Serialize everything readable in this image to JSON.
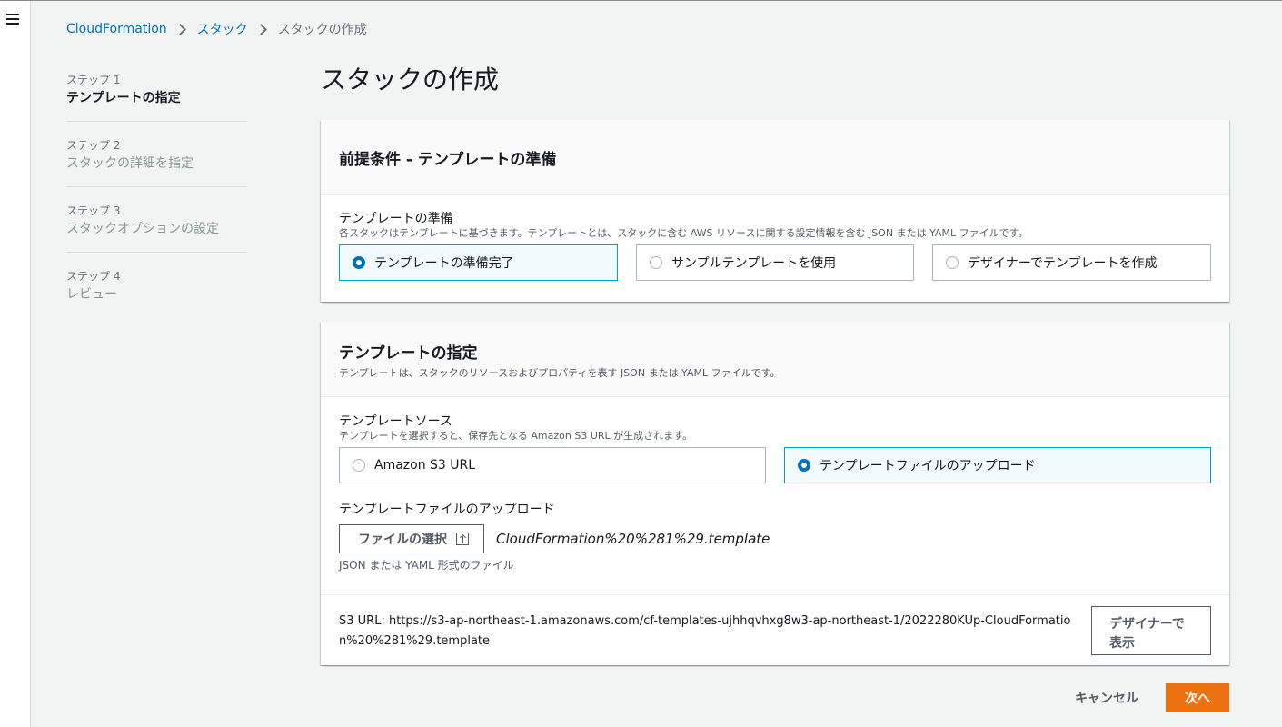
{
  "breadcrumb": {
    "items": [
      "CloudFormation",
      "スタック",
      "スタックの作成"
    ]
  },
  "steps": [
    {
      "num": "ステップ 1",
      "label": "テンプレートの指定",
      "active": true
    },
    {
      "num": "ステップ 2",
      "label": "スタックの詳細を指定",
      "active": false
    },
    {
      "num": "ステップ 3",
      "label": "スタックオプションの設定",
      "active": false
    },
    {
      "num": "ステップ 4",
      "label": "レビュー",
      "active": false
    }
  ],
  "page_title": "スタックの作成",
  "prereq": {
    "title": "前提条件 - テンプレートの準備",
    "field_label": "テンプレートの準備",
    "field_desc": "各スタックはテンプレートに基づきます。テンプレートとは、スタックに含む AWS リソースに関する設定情報を含む JSON または YAML ファイルです。",
    "options": [
      {
        "label": "テンプレートの準備完了",
        "selected": true
      },
      {
        "label": "サンプルテンプレートを使用",
        "selected": false
      },
      {
        "label": "デザイナーでテンプレートを作成",
        "selected": false
      }
    ]
  },
  "spec": {
    "title": "テンプレートの指定",
    "desc": "テンプレートは、スタックのリソースおよびプロパティを表す JSON または YAML ファイルです。",
    "source_label": "テンプレートソース",
    "source_desc": "テンプレートを選択すると、保存先となる Amazon S3 URL が生成されます。",
    "source_options": [
      {
        "label": "Amazon S3 URL",
        "selected": false
      },
      {
        "label": "テンプレートファイルのアップロード",
        "selected": true
      }
    ],
    "upload_label": "テンプレートファイルのアップロード",
    "choose_file_label": "ファイルの選択",
    "file_name": "CloudFormation%20%281%29.template",
    "file_hint": "JSON または YAML 形式のファイル",
    "s3_url_text": "S3 URL:  https://s3-ap-northeast-1.amazonaws.com/cf-templates-ujhhqvhxg8w3-ap-northeast-1/2022280KUp-CloudFormation%20%281%29.template",
    "designer_line1": "デザイナーで",
    "designer_line2": "表示"
  },
  "footer": {
    "cancel_label": "キャンセル",
    "next_label": "次へ"
  },
  "colors": {
    "accent": "#0073bb",
    "primary_button": "#ec7211",
    "selected_tile_border": "#00a1c9"
  }
}
